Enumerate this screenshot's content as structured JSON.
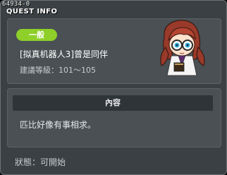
{
  "window": {
    "quest_id": "64934-0",
    "title": "QUEST INFO"
  },
  "quest": {
    "tag": "一般",
    "name": "[拟真机器人3]曾是同伴",
    "level_label": "建議等級：101～105"
  },
  "content": {
    "header": "內容",
    "body": "匹比好像有事相求。"
  },
  "status": {
    "text": "狀態：可開始"
  },
  "icons": {
    "npc": "npc-girl-portrait-icon"
  },
  "colors": {
    "tag_bg": "#8ecf29",
    "panel_bg": "#4a5054",
    "window_bg": "#3b4044"
  }
}
